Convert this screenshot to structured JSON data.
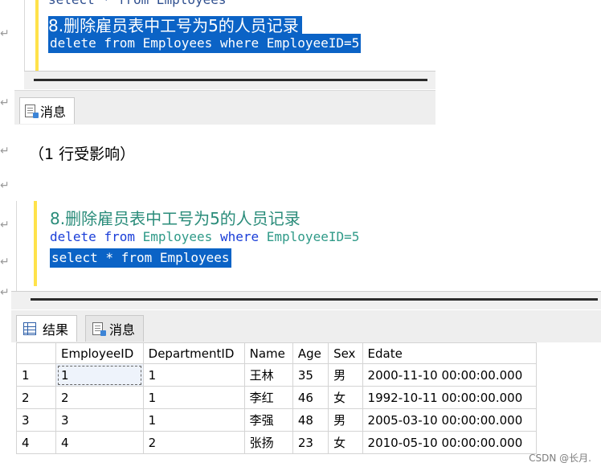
{
  "top": {
    "prev_line": "select * from Employees",
    "comment": "8.删除雇员表中工号为5的人员记录",
    "delete_line": "delete from Employees where EmployeeID=5",
    "messages_tab": "消息",
    "message_text": "（1 行受影响）"
  },
  "bottom": {
    "comment": "8.删除雇员表中工号为5的人员记录",
    "delete_kw": "delete",
    "from_kw": "from",
    "table": "Employees",
    "where_kw": "where",
    "cond": "EmployeeID=5",
    "select_line": "select * from Employees",
    "results_tab": "结果",
    "messages_tab": "消息"
  },
  "grid": {
    "columns": [
      "",
      "EmployeeID",
      "DepartmentID",
      "Name",
      "Age",
      "Sex",
      "Edate"
    ],
    "rows": [
      [
        "1",
        "1",
        "1",
        "王林",
        "35",
        "男",
        "2000-11-10 00:00:00.000"
      ],
      [
        "2",
        "2",
        "1",
        "李红",
        "46",
        "女",
        "1992-10-11 00:00:00.000"
      ],
      [
        "3",
        "3",
        "1",
        "李强",
        "48",
        "男",
        "2005-03-10 00:00:00.000"
      ],
      [
        "4",
        "4",
        "2",
        "张扬",
        "23",
        "女",
        "2010-05-10 00:00:00.000"
      ]
    ]
  },
  "watermark": "CSDN @长月.",
  "colors": {
    "selection": "#0b63c6",
    "keyword": "#1a3ed8",
    "table_name": "#2f9a88",
    "comment": "#2a8c7a",
    "margin": "#ffe24a"
  }
}
